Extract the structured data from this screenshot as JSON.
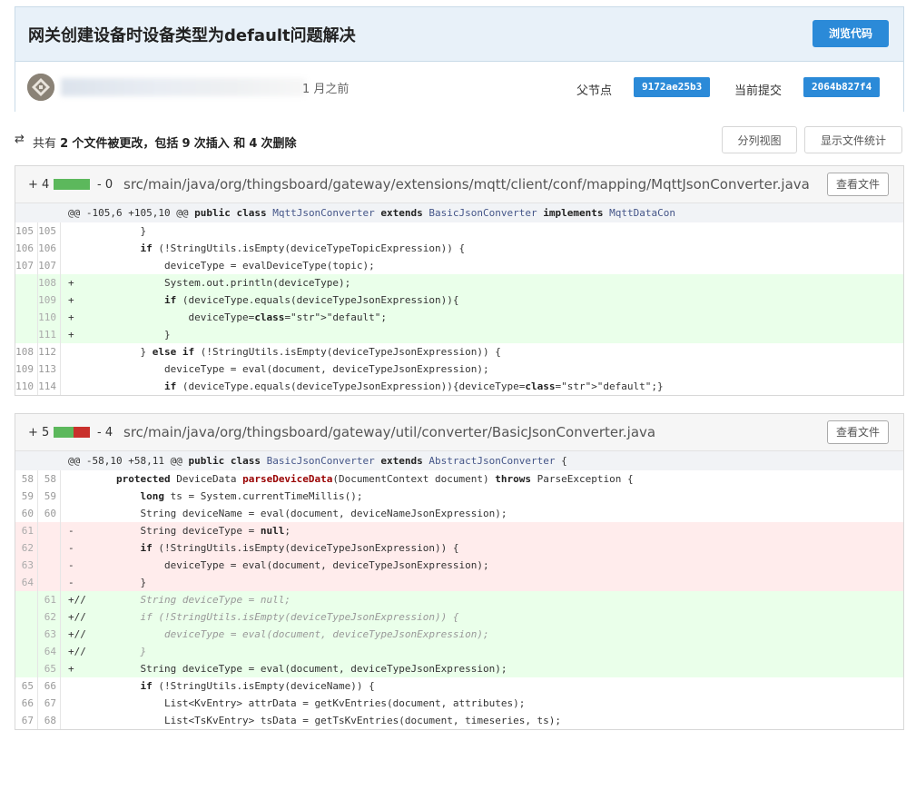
{
  "commit": {
    "title": "网关创建设备时设备类型为default问题解决",
    "browse_button": "浏览代码",
    "time_ago": "1 月之前",
    "parent_label": "父节点",
    "parent_sha": "9172ae25b3",
    "current_label": "当前提交",
    "current_sha": "2064b827f4",
    "avatar_icon": "identicon-avatar"
  },
  "summary": {
    "icon": "refresh-arrows-icon",
    "prefix": "共有",
    "files_changed": "2",
    "middle1": "个文件被更改，包括",
    "insertions": "9",
    "middle2": "次插入 和",
    "deletions": "4",
    "suffix": "次删除",
    "split_view_button": "分列视图",
    "show_stats_button": "显示文件统计"
  },
  "colors": {
    "primary": "#2b8ad8",
    "add_bar": "#5cb85c",
    "del_bar": "#c9302c",
    "add_bg": "#eaffea",
    "del_bg": "#ffecec"
  },
  "files": [
    {
      "additions": "+ 4",
      "deletions": "- 0",
      "path": "src/main/java/org/thingsboard/gateway/extensions/mqtt/client/conf/mapping/MqttJsonConverter.java",
      "view_button": "查看文件",
      "bar_added_fraction": 1.0,
      "hunk": "@@ -105,6 +105,10 @@ public class MqttJsonConverter extends BasicJsonConverter implements MqttDataCon",
      "lines": [
        {
          "type": "ctx",
          "old": "105",
          "new": "105",
          "text": "            }"
        },
        {
          "type": "ctx",
          "old": "106",
          "new": "106",
          "text": "            if (!StringUtils.isEmpty(deviceTypeTopicExpression)) {"
        },
        {
          "type": "ctx",
          "old": "107",
          "new": "107",
          "text": "                deviceType = evalDeviceType(topic);"
        },
        {
          "type": "add",
          "old": "",
          "new": "108",
          "text": "+               System.out.println(deviceType);"
        },
        {
          "type": "add",
          "old": "",
          "new": "109",
          "text": "+               if (deviceType.equals(deviceTypeJsonExpression)){"
        },
        {
          "type": "add",
          "old": "",
          "new": "110",
          "text": "+                   deviceType=\"default\";"
        },
        {
          "type": "add",
          "old": "",
          "new": "111",
          "text": "+               }"
        },
        {
          "type": "ctx",
          "old": "108",
          "new": "112",
          "text": "            } else if (!StringUtils.isEmpty(deviceTypeJsonExpression)) {"
        },
        {
          "type": "ctx",
          "old": "109",
          "new": "113",
          "text": "                deviceType = eval(document, deviceTypeJsonExpression);"
        },
        {
          "type": "ctx",
          "old": "110",
          "new": "114",
          "text": "                if (deviceType.equals(deviceTypeJsonExpression)){deviceType=\"default\";}"
        }
      ]
    },
    {
      "additions": "+ 5",
      "deletions": "- 4",
      "path": "src/main/java/org/thingsboard/gateway/util/converter/BasicJsonConverter.java",
      "view_button": "查看文件",
      "bar_added_fraction": 0.56,
      "hunk": "@@ -58,10 +58,11 @@ public class BasicJsonConverter extends AbstractJsonConverter {",
      "lines": [
        {
          "type": "ctx",
          "old": "58",
          "new": "58",
          "text": "        protected DeviceData parseDeviceData(DocumentContext document) throws ParseException {"
        },
        {
          "type": "ctx",
          "old": "59",
          "new": "59",
          "text": "            long ts = System.currentTimeMillis();"
        },
        {
          "type": "ctx",
          "old": "60",
          "new": "60",
          "text": "            String deviceName = eval(document, deviceNameJsonExpression);"
        },
        {
          "type": "del",
          "old": "61",
          "new": "",
          "text": "-           String deviceType = null;"
        },
        {
          "type": "del",
          "old": "62",
          "new": "",
          "text": "-           if (!StringUtils.isEmpty(deviceTypeJsonExpression)) {"
        },
        {
          "type": "del",
          "old": "63",
          "new": "",
          "text": "-               deviceType = eval(document, deviceTypeJsonExpression);"
        },
        {
          "type": "del",
          "old": "64",
          "new": "",
          "text": "-           }"
        },
        {
          "type": "add",
          "old": "",
          "new": "61",
          "text": "+//         String deviceType = null;"
        },
        {
          "type": "add",
          "old": "",
          "new": "62",
          "text": "+//         if (!StringUtils.isEmpty(deviceTypeJsonExpression)) {"
        },
        {
          "type": "add",
          "old": "",
          "new": "63",
          "text": "+//             deviceType = eval(document, deviceTypeJsonExpression);"
        },
        {
          "type": "add",
          "old": "",
          "new": "64",
          "text": "+//         }"
        },
        {
          "type": "add",
          "old": "",
          "new": "65",
          "text": "+           String deviceType = eval(document, deviceTypeJsonExpression);"
        },
        {
          "type": "ctx",
          "old": "65",
          "new": "66",
          "text": "            if (!StringUtils.isEmpty(deviceName)) {"
        },
        {
          "type": "ctx",
          "old": "66",
          "new": "67",
          "text": "                List<KvEntry> attrData = getKvEntries(document, attributes);"
        },
        {
          "type": "ctx",
          "old": "67",
          "new": "68",
          "text": "                List<TsKvEntry> tsData = getTsKvEntries(document, timeseries, ts);"
        }
      ]
    }
  ]
}
